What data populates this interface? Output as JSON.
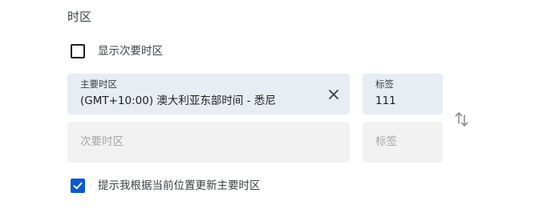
{
  "section": {
    "title": "时区"
  },
  "show_secondary": {
    "label": "显示次要时区",
    "checked": false
  },
  "primary_timezone": {
    "label": "主要时区",
    "value": "(GMT+10:00) 澳大利亚东部时间 - 悉尼"
  },
  "primary_tag": {
    "label": "标签",
    "value": "111"
  },
  "secondary_timezone": {
    "placeholder": "次要时区"
  },
  "secondary_tag": {
    "placeholder": "标签"
  },
  "auto_update": {
    "label": "提示我根据当前位置更新主要时区",
    "checked": true
  },
  "icons": {
    "clear": "close-icon",
    "swap": "swap-vertical-icon",
    "check": "check-icon"
  },
  "colors": {
    "accent": "#0b57d0",
    "filled_field_bg": "#e8ecf3",
    "empty_field_bg": "#f2f2f2"
  }
}
